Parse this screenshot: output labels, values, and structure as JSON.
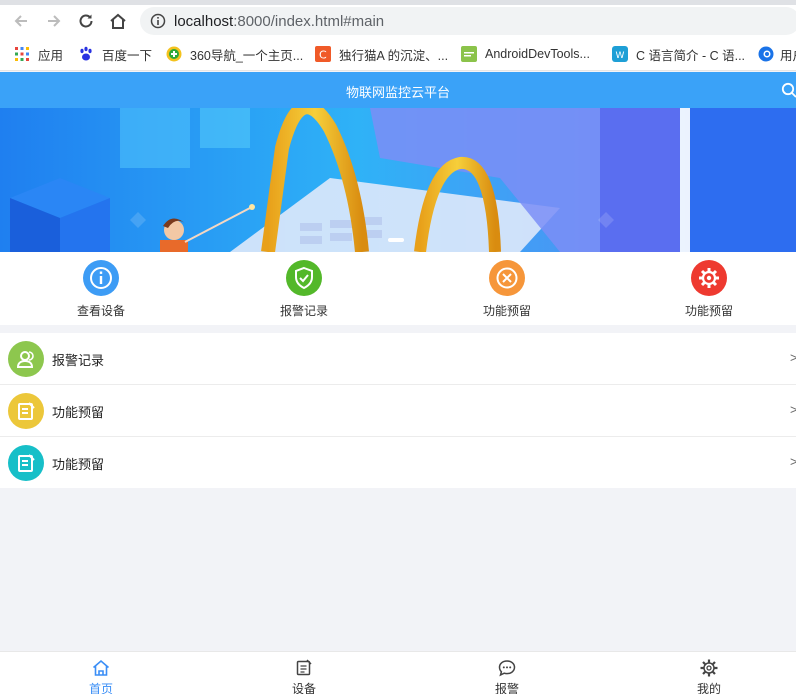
{
  "browser": {
    "url_host": "localhost",
    "url_rest": ":8000/index.html#main",
    "bookmarks": [
      {
        "label": "应用",
        "color": "#e8453c"
      },
      {
        "label": "百度一下",
        "color": "#2932e1"
      },
      {
        "label": "360导航_一个主页...",
        "color": "#2ea83a"
      },
      {
        "label": "独行猫A 的沉淀、...",
        "color": "#f05a28"
      },
      {
        "label": "AndroidDevTools...",
        "color": "#8bc34a"
      },
      {
        "label": "C 语言简介 - C 语...",
        "color": "#1e9fd6"
      },
      {
        "label": "用户",
        "color": "#1a73e8"
      }
    ]
  },
  "app": {
    "title": "物联网监控云平台",
    "accent": "#3aa2f8"
  },
  "quick_menu": [
    {
      "label": "查看设备",
      "icon": "info-icon",
      "color": "#3d9cf5"
    },
    {
      "label": "报警记录",
      "icon": "shield-check-icon",
      "color": "#53b82a"
    },
    {
      "label": "功能预留",
      "icon": "close-circle-icon",
      "color": "#f6963a"
    },
    {
      "label": "功能预留",
      "icon": "gear-icon",
      "color": "#ee3a30"
    }
  ],
  "list": [
    {
      "label": "报警记录",
      "icon": "users-icon",
      "color": "#8dc74e",
      "arrow": ">"
    },
    {
      "label": "功能预留",
      "icon": "edit-icon",
      "color": "#ecc73a",
      "arrow": ">"
    },
    {
      "label": "功能预留",
      "icon": "edit-icon",
      "color": "#17bfc8",
      "arrow": ">"
    }
  ],
  "tabbar": [
    {
      "label": "首页",
      "icon": "home-icon",
      "active": true
    },
    {
      "label": "设备",
      "icon": "edit-icon",
      "active": false
    },
    {
      "label": "报警",
      "icon": "chat-icon",
      "active": false
    },
    {
      "label": "我的",
      "icon": "gear-icon",
      "active": false
    }
  ]
}
